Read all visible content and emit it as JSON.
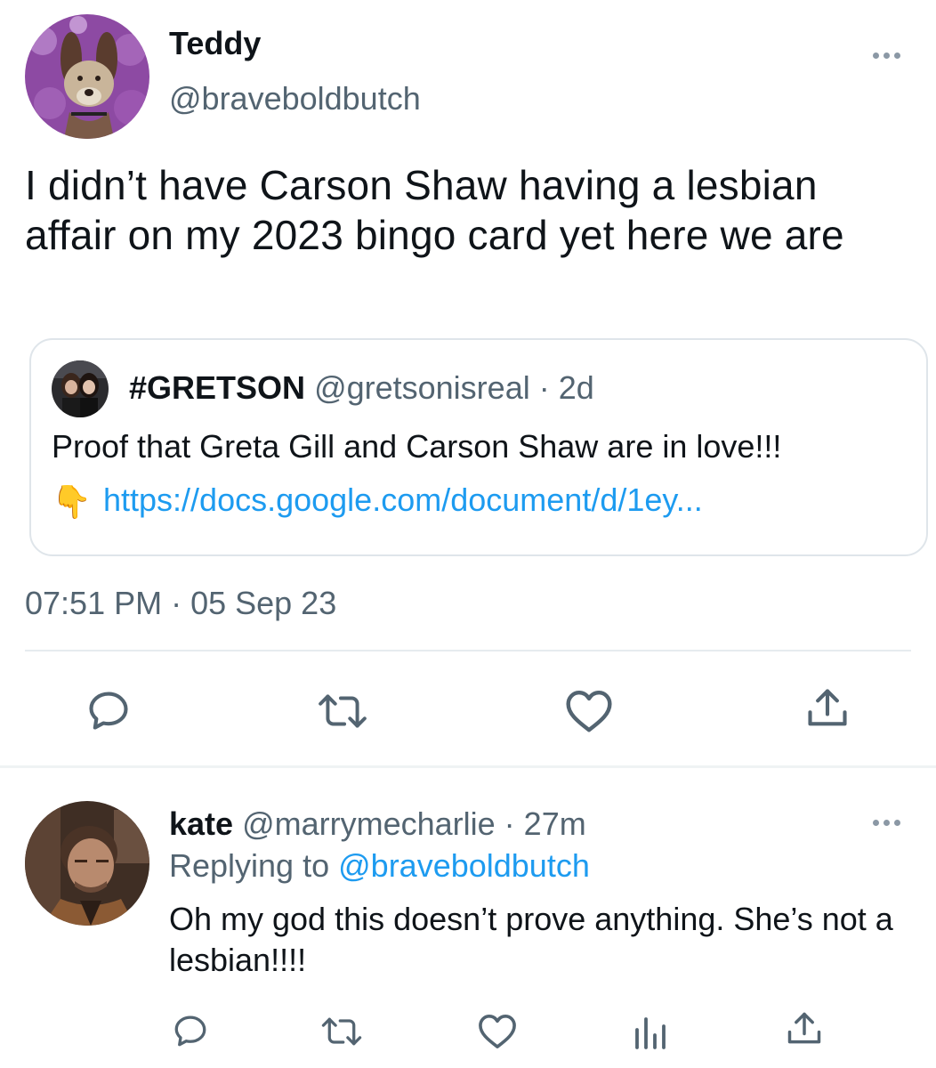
{
  "main_tweet": {
    "display_name": "Teddy",
    "handle": "@braveboldbutch",
    "text": "I didn’t have Carson Shaw having a lesbian affair on my 2023 bingo card yet here we are",
    "timestamp": "07:51 PM · 05 Sep 23",
    "more_icon": "more-horizontal-icon"
  },
  "quoted_tweet": {
    "display_name": "#GRETSON",
    "handle": "@gretsonisreal",
    "age": "2d",
    "text": "Proof that Greta Gill and Carson Shaw are in love!!!",
    "emoji": "👇",
    "link": "https://docs.google.com/document/d/1ey..."
  },
  "main_actions": [
    "reply-icon",
    "retweet-icon",
    "like-icon",
    "share-icon"
  ],
  "reply": {
    "display_name": "kate",
    "handle": "@marrymecharlie",
    "age": "27m",
    "replying_label": "Replying to",
    "replying_to": "@braveboldbutch",
    "text": "Oh my god this doesn’t prove anything. She’s not a lesbian!!!!",
    "actions": [
      "reply-icon",
      "retweet-icon",
      "like-icon",
      "analytics-icon",
      "share-icon"
    ]
  },
  "colors": {
    "text": "#0f1419",
    "secondary": "#536471",
    "link": "#1d9bf0",
    "icon": "#536471",
    "border": "#dfe5ea"
  }
}
